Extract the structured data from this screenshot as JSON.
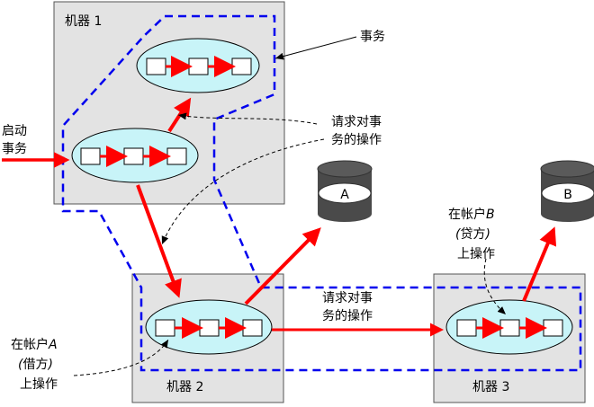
{
  "machines": {
    "m1": "机器 1",
    "m2": "机器 2",
    "m3": "机器 3"
  },
  "labels": {
    "transaction": "事务",
    "start_line1": "启动",
    "start_line2": "事务",
    "request_ops_line1": "请求对事",
    "request_ops_line2": "务的操作",
    "net_request_line1": "请求对事",
    "net_request_line2": "务的操作"
  },
  "databases": {
    "a": "A",
    "b": "B"
  },
  "account_a": {
    "line1_prefix": "在帐户",
    "line1_var": "A",
    "line2_open": "(",
    "line2_text": "借方",
    "line2_close": ")",
    "line3": "上操作"
  },
  "account_b": {
    "line1_prefix": "在帐户",
    "line1_var": "B",
    "line2_open": "(",
    "line2_text": "贷方",
    "line2_close": ")",
    "line3": "上操作"
  },
  "colors": {
    "machine_fill": "#e3e3e3",
    "machine_stroke": "#555555",
    "process_fill": "#c8f4f8",
    "arrow_red": "#ff0000",
    "transaction_boundary": "#0000ee",
    "db_body": "#4a4a4a"
  }
}
